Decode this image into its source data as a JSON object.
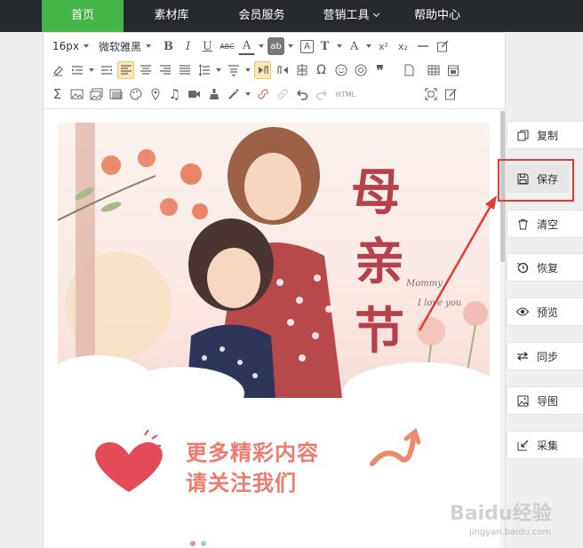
{
  "nav": {
    "items": [
      {
        "label": "首页",
        "active": true
      },
      {
        "label": "素材库",
        "active": false
      },
      {
        "label": "会员服务",
        "active": false
      },
      {
        "label": "营销工具",
        "active": false,
        "has_dropdown": true
      },
      {
        "label": "帮助中心",
        "active": false
      }
    ],
    "active_color": "#44b549",
    "bg_color": "#262a2c"
  },
  "toolbar": {
    "font_size": "16px",
    "font_family": "微软雅黑",
    "bold": "B",
    "italic": "I",
    "underline": "U",
    "strike": "ABC",
    "font_color": "A",
    "bg_color_label": "ab",
    "border": "A",
    "text_format": "T",
    "case": "A",
    "superscript": "x²",
    "subscript": "x₂",
    "omega": "Ω",
    "html": "HTML"
  },
  "banner": {
    "title_chars": [
      "母",
      "亲",
      "节"
    ],
    "script_line1": "Mommy",
    "script_line2": "I love you"
  },
  "promo": {
    "line1": "更多精彩内容",
    "line2": "请关注我们"
  },
  "panel": {
    "buttons": [
      {
        "label": "复制",
        "icon": "copy-icon"
      },
      {
        "label": "保存",
        "icon": "save-icon"
      },
      {
        "label": "清空",
        "icon": "trash-icon"
      },
      {
        "label": "恢复",
        "icon": "history-icon"
      },
      {
        "label": "预览",
        "icon": "eye-icon"
      },
      {
        "label": "同步",
        "icon": "sync-icon"
      },
      {
        "label": "导图",
        "icon": "image-icon"
      },
      {
        "label": "采集",
        "icon": "collect-icon"
      }
    ],
    "highlight_color": "#e53935"
  },
  "watermark": {
    "text": "Baidu经验",
    "url": "jingyan.baidu.com"
  }
}
